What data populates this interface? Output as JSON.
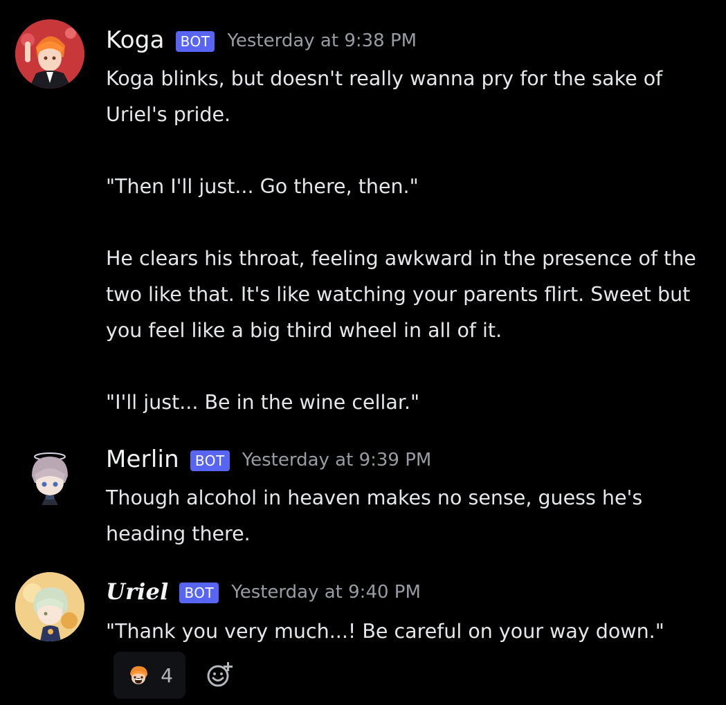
{
  "messages": [
    {
      "username": "Koga",
      "badge": "BOT",
      "timestamp": "Yesterday at 9:38 PM",
      "avatar_icon": "koga-avatar",
      "paragraphs": [
        "Koga blinks, but doesn't really wanna pry for the sake of Uriel's pride.",
        "\"Then I'll just... Go there, then.\"",
        "He clears his throat, feeling awkward in the presence of the two like that. It's like watching your parents flirt. Sweet but you feel like a big third wheel in all of it.",
        "\"I'll just... Be in the wine cellar.\""
      ]
    },
    {
      "username": "Merlin",
      "badge": "BOT",
      "timestamp": "Yesterday at 9:39 PM",
      "avatar_icon": "merlin-avatar",
      "paragraphs": [
        "Though alcohol in heaven makes no sense, guess he's heading there."
      ]
    },
    {
      "username": "Uriel",
      "badge": "BOT",
      "timestamp": "Yesterday at 9:40 PM",
      "avatar_icon": "uriel-avatar",
      "paragraphs": [
        "\"Thank you very much...! Be careful on your way down.\""
      ],
      "reaction": {
        "emoji_icon": "koga-emoji-icon",
        "count": "4"
      }
    }
  ],
  "colors": {
    "background": "#000000",
    "bot_badge": "#5865f2",
    "timestamp": "#9a9ca3",
    "text": "#e6e7ea"
  }
}
